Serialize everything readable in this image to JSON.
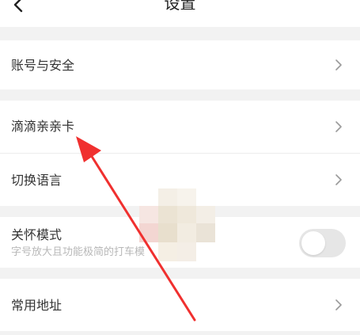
{
  "header": {
    "title": "设置",
    "back_icon": "back-chevron-icon"
  },
  "sections": [
    {
      "items": [
        {
          "label": "账号与安全",
          "icon": "chevron-right-icon"
        }
      ]
    },
    {
      "items": [
        {
          "label": "滴滴亲亲卡",
          "icon": "chevron-right-icon"
        },
        {
          "label": "切换语言",
          "icon": "chevron-right-icon"
        }
      ]
    },
    {
      "items": [
        {
          "label": "关怀模式",
          "subtitle": "字号放大且功能极简的打车模",
          "toggle": "off"
        }
      ]
    },
    {
      "items": [
        {
          "label": "常用地址",
          "icon": "chevron-right-icon"
        }
      ]
    }
  ],
  "annotation": {
    "arrow_color": "#f0302f"
  }
}
